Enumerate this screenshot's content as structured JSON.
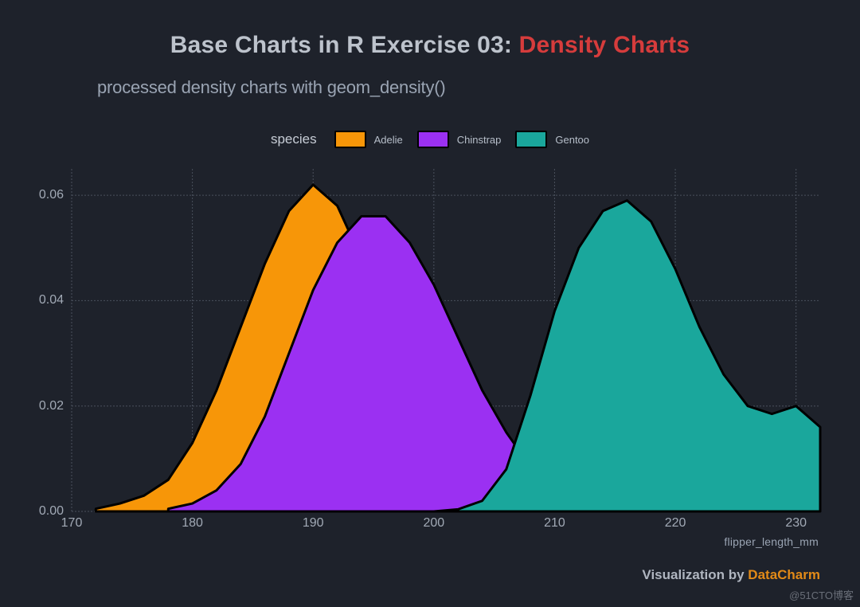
{
  "title_part1": "Base Charts in R Exercise 03: ",
  "title_part2": "Density Charts",
  "subtitle": "processed density charts with geom_density()",
  "legend_title": "species",
  "legend": [
    {
      "name": "Adelie",
      "color": "#f79608"
    },
    {
      "name": "Chinstrap",
      "color": "#9b30f2"
    },
    {
      "name": "Gentoo",
      "color": "#1aa79c"
    }
  ],
  "xlabel": "flipper_length_mm",
  "x_ticks": [
    170,
    180,
    190,
    200,
    210,
    220,
    230
  ],
  "y_ticks": [
    "0.00",
    "0.02",
    "0.04",
    "0.06"
  ],
  "x_range": [
    170,
    232
  ],
  "y_range": [
    0,
    0.065
  ],
  "credit_prefix": "Visualization by ",
  "credit_author": "DataCharm",
  "watermark": "@51CTO博客",
  "chart_data": {
    "type": "area",
    "title": "Base Charts in R Exercise 03: Density Charts",
    "subtitle": "processed density charts with geom_density()",
    "xlabel": "flipper_length_mm",
    "ylabel": "",
    "xlim": [
      170,
      232
    ],
    "ylim": [
      0,
      0.065
    ],
    "series": [
      {
        "name": "Adelie",
        "color": "#f79608",
        "x": [
          172,
          174,
          176,
          178,
          180,
          182,
          184,
          186,
          188,
          190,
          192,
          194,
          196,
          198,
          200,
          202,
          204,
          206,
          208
        ],
        "y": [
          0.0005,
          0.0015,
          0.003,
          0.006,
          0.013,
          0.023,
          0.035,
          0.047,
          0.057,
          0.062,
          0.058,
          0.048,
          0.036,
          0.025,
          0.016,
          0.009,
          0.0045,
          0.002,
          0.0005
        ]
      },
      {
        "name": "Chinstrap",
        "color": "#9b30f2",
        "x": [
          178,
          180,
          182,
          184,
          186,
          188,
          190,
          192,
          194,
          196,
          198,
          200,
          202,
          204,
          206,
          208,
          210,
          212,
          214,
          216
        ],
        "y": [
          0.0005,
          0.0015,
          0.004,
          0.009,
          0.018,
          0.03,
          0.042,
          0.051,
          0.056,
          0.056,
          0.051,
          0.043,
          0.033,
          0.023,
          0.015,
          0.0085,
          0.0042,
          0.002,
          0.0009,
          0.0003
        ]
      },
      {
        "name": "Gentoo",
        "color": "#1aa79c",
        "x": [
          200,
          202,
          204,
          206,
          208,
          210,
          212,
          214,
          216,
          218,
          220,
          222,
          224,
          226,
          228,
          230,
          232
        ],
        "y": [
          0.0,
          0.0004,
          0.002,
          0.008,
          0.022,
          0.038,
          0.05,
          0.057,
          0.059,
          0.055,
          0.046,
          0.035,
          0.026,
          0.02,
          0.0185,
          0.02,
          0.016
        ]
      }
    ],
    "legend_position": "top",
    "grid": true
  }
}
